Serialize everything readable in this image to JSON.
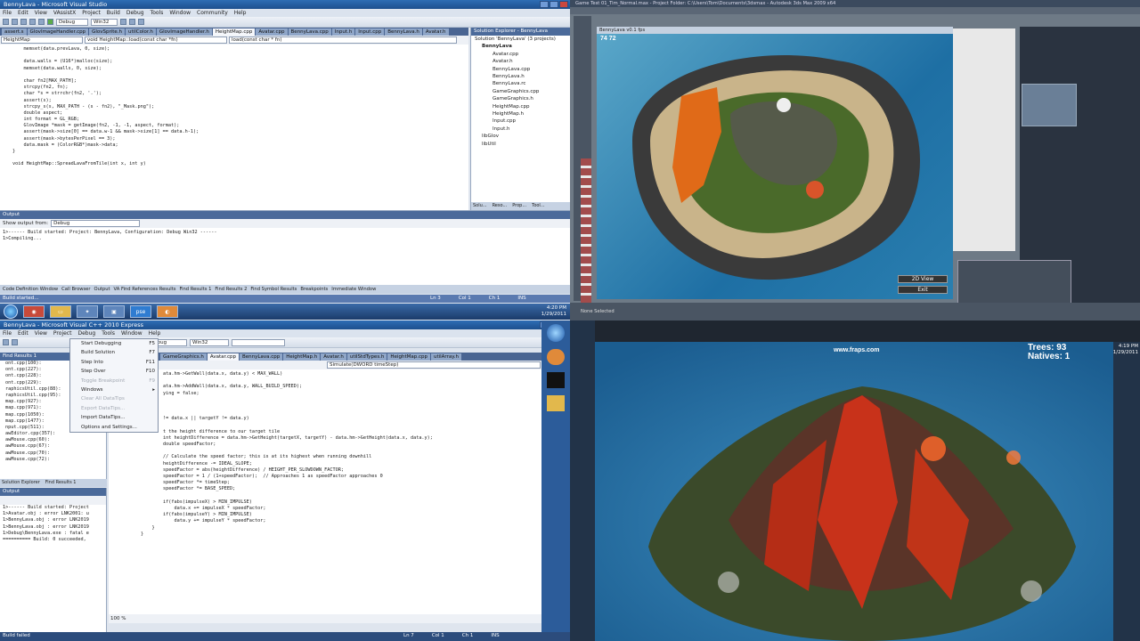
{
  "q1": {
    "title": "BennyLava - Microsoft Visual Studio",
    "menu": [
      "File",
      "Edit",
      "View",
      "VAssistX",
      "Project",
      "Build",
      "Debug",
      "Tools",
      "Window",
      "Community",
      "Help"
    ],
    "config": "Debug",
    "platform": "Win32",
    "tabs": [
      "assert.s",
      "GlovImageHandler.cpp",
      "GlovSprite.h",
      "utilColor.h",
      "GlovImageHandler.h",
      "HeightMap.cpp",
      "Avatar.cpp",
      "BennyLava.cpp",
      "Input.h",
      "Input.cpp",
      "BennyLava.h",
      "Avatar.h"
    ],
    "active_tab": "HeightMap.cpp",
    "scope_left": "HeightMap",
    "scope_mid": "void HeightMap::load(const char *fn)",
    "scope_right": "load(const char * fn)",
    "code": [
      "    memset(data.prevLava, 0, size);",
      "",
      "    data.walls = (U16*)malloc(size);",
      "    memset(data.walls, 0, size);",
      "",
      "    char fn2[MAX_PATH];",
      "    strcpy(fn2, fn);",
      "    char *s = strrchr(fn2, '.');",
      "    assert(s);",
      "    strcpy_s(s, MAX_PATH - (s - fn2), \"_Mask.png\");",
      "    double aspect;",
      "    int format = GL_RGB;",
      "    GlovImage *mask = getImage(fn2, -1, -1, aspect, format);",
      "    assert(mask->size[0] == data.w-1 && mask->size[1] == data.h-1);",
      "    assert(mask->bytesPerPixel == 3);",
      "    data.mask = (ColorRGB*)mask->data;",
      "}",
      "",
      "void HeightMap::SpreadLavaFromTile(int x, int y)"
    ],
    "solution_title": "Solution Explorer - BennyLava",
    "solution_root": "Solution 'BennyLava' (3 projects)",
    "project": "BennyLava",
    "files": [
      "Avatar.cpp",
      "Avatar.h",
      "BennyLava.cpp",
      "BennyLava.h",
      "BennyLava.rc",
      "GameGraphics.cpp",
      "GameGraphics.h",
      "HeightMap.cpp",
      "HeightMap.h",
      "Input.cpp",
      "Input.h"
    ],
    "other_projects": [
      "libGlov",
      "libUtil"
    ],
    "side_tabs": [
      "Solu...",
      "Reso...",
      "Prop...",
      "Tool..."
    ],
    "output_title": "Output",
    "output_show": "Show output from:",
    "output_source": "Debug",
    "output_lines": [
      "1>------ Build started: Project: BennyLava, Configuration: Debug Win32 ------",
      "1>Compiling..."
    ],
    "bottom_tabs": [
      "Code Definition Window",
      "Call Browser",
      "Output",
      "VA Find References Results",
      "Find Results 1",
      "Find Results 2",
      "Find Symbol Results",
      "Breakpoints",
      "Immediate Window"
    ],
    "status": "Build started...",
    "status_ln": "Ln 3",
    "status_col": "Col 1",
    "status_ch": "Ch 1",
    "status_ins": "INS",
    "clock_time": "4:20 PM",
    "clock_date": "1/29/2011"
  },
  "q2": {
    "title": "Game Test 01_Tim_Normal.max - Project Folder: C:\\Users\\Tom\\Documents\\3dsmax - Autodesk 3ds Max 2009 x64",
    "viewport_title": "BennyLava v0.1 fps",
    "fps": "74 72",
    "btn_2dview": "2D View",
    "btn_exit": "Exit",
    "status": "None Selected"
  },
  "q3": {
    "title": "BennyLava - Microsoft Visual C++ 2010 Express",
    "menu": [
      "File",
      "Edit",
      "View",
      "Project",
      "Debug",
      "Tools",
      "Window",
      "Help"
    ],
    "config": "Debug",
    "platform": "Win32",
    "find_title": "Find Results 1",
    "find_lines": [
      "ont.cpp(100):",
      "ont.cpp(227):",
      "ont.cpp(228):",
      "ont.cpp(229):",
      "raphicsUtil.cpp(88):",
      "raphicsUtil.cpp(95):",
      "map.cpp(927):",
      "map.cpp(971):",
      "map.cpp(1050):",
      "map.cpp(1477):",
      "nput.cpp(511):",
      "awEditor.cpp(357):",
      "awMouse.cpp(60):",
      "awMouse.cpp(67):",
      "awMouse.cpp(70):",
      "awMouse.cpp(72):"
    ],
    "left_tabs": [
      "Solution Explorer",
      "Find Results 1"
    ],
    "output_title": "Output",
    "output_lines": [
      "1>------ Build started: Project",
      "1>Avatar.obj : error LNK2001: u",
      "1>BennyLava.obj : error LNK2019",
      "1>BennyLava.obj : error LNK2019",
      "1>Debug\\BennyLava.exe : fatal e",
      "========== Build: 0 succeeded,"
    ],
    "tabs": [
      "GameGraphics.h",
      "Avatar.cpp",
      "BennyLava.cpp",
      "HeightMap.h",
      "Avatar.h",
      "utilStdTypes.h",
      "HeightMap.cpp",
      "utilArray.h"
    ],
    "active_tab": "Avatar.cpp",
    "scope": "Simulate(DWORD timeStep)",
    "code": [
      "        ata.hm->GetWall(data.x, data.y) < MAX_WALL)",
      "",
      "        ata.hm->AddWall(data.x, data.y, WALL_BUILD_SPEED);",
      "        ying = false;",
      "",
      "",
      "",
      "        != data.x || targetY != data.y)",
      "",
      "        t the height difference to our target tile",
      "        int heightDifference = data.hm->GetHeight(targetX, targetY) - data.hm->GetHeight(data.x, data.y);",
      "        double speedFactor;",
      "",
      "        // Calculate the speed factor; this is at its highest when running downhill",
      "        heightDifference -= IDEAL_SLOPE;",
      "        speedFactor = abs(heightDifference) / HEIGHT_PER_SLOWDOWN_FACTOR;",
      "        speedFactor = 1 / (1+speedFactor);  // Approaches 1 as speedFactor approaches 0",
      "        speedFactor *= timeStep;",
      "        speedFactor *= BASE_SPEED;",
      "",
      "        if(fabs(impulseX) > MIN_IMPULSE)",
      "            data.x += impulseX * speedFactor;",
      "        if(fabs(impulseY) > MIN_IMPULSE)",
      "            data.y += impulseY * speedFactor;",
      "    }",
      "}"
    ],
    "debug_menu": [
      {
        "label": "Start Debugging",
        "key": "F5",
        "enabled": true
      },
      {
        "label": "Build Solution",
        "key": "F7",
        "enabled": true
      },
      {
        "label": "Step Into",
        "key": "F11",
        "enabled": true
      },
      {
        "label": "Step Over",
        "key": "F10",
        "enabled": true
      },
      {
        "label": "Toggle Breakpoint",
        "key": "F9",
        "enabled": false
      },
      {
        "label": "Windows",
        "key": "▸",
        "enabled": true
      },
      {
        "label": "Clear All DataTips",
        "key": "",
        "enabled": false
      },
      {
        "label": "Export DataTips...",
        "key": "",
        "enabled": false
      },
      {
        "label": "Import DataTips...",
        "key": "",
        "enabled": true
      },
      {
        "label": "Options and Settings...",
        "key": "",
        "enabled": true
      }
    ],
    "zoom": "100 %",
    "status": "Build failed",
    "status_ln": "Ln 7",
    "status_col": "Col 1",
    "status_ch": "Ch 1",
    "status_ins": "INS",
    "clock_time": "4:19 PM",
    "clock_date": "1/29/2011"
  },
  "q4": {
    "watermark": "www.fraps.com",
    "trees_label": "Trees: 93",
    "natives_label": "Natives: 1",
    "clock_time": "4:19 PM",
    "clock_date": "1/29/2011"
  },
  "colors": {
    "vs_blue": "#2e6db5",
    "lava": "#d23a12",
    "ocean": "#2b6fa8",
    "sand": "#c9b48a",
    "grass": "#4a6a2a"
  }
}
